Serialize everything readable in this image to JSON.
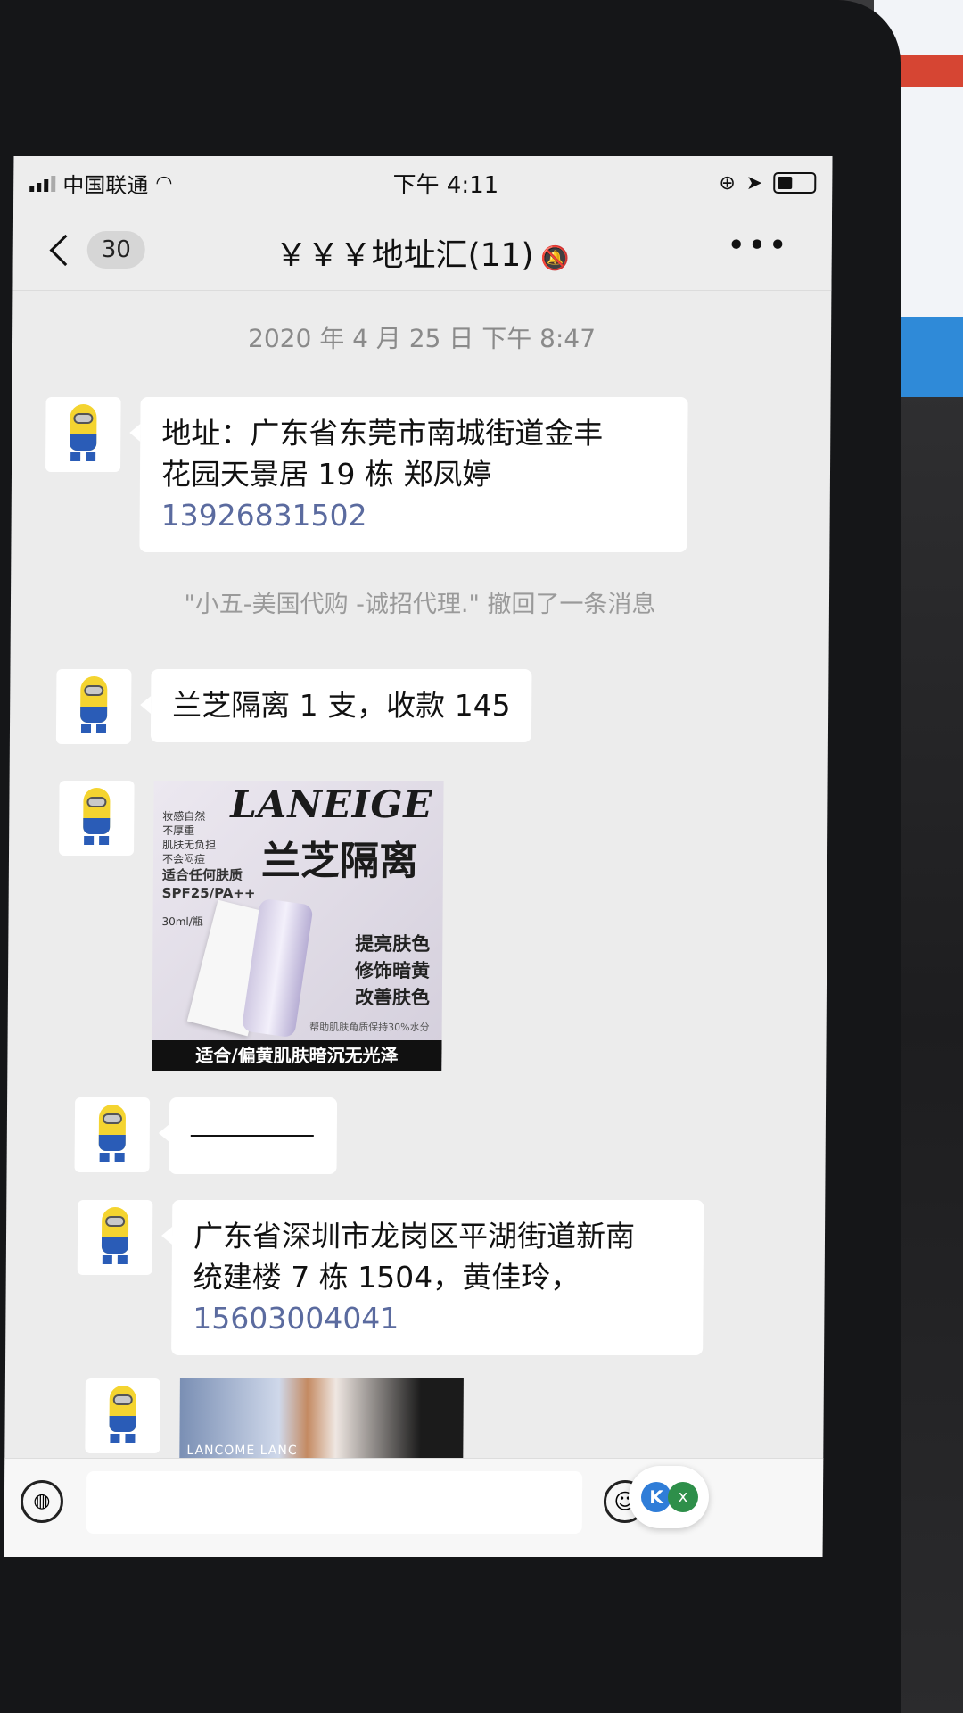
{
  "status_bar": {
    "carrier": "中国联通",
    "time": "下午 4:11"
  },
  "nav": {
    "unread_count": "30",
    "title": "￥￥￥地址汇(11)"
  },
  "chat": {
    "timestamp": "2020 年 4 月 25 日 下午 8:47",
    "messages": [
      {
        "lines": [
          "地址：广东省东莞市南城街道金丰",
          "花园天景居 19 栋 郑凤婷"
        ],
        "phone": "13926831502"
      },
      {
        "text": "兰芝隔离 1 支，收款 145"
      },
      {
        "lines": [
          "广东省深圳市龙岗区平湖街道新南",
          "统建楼 7 栋 1504，黄佳玲，"
        ],
        "phone": "15603004041"
      }
    ],
    "recall_notice": "\"小五-美国代购 -诚招代理.\" 撤回了一条消息"
  },
  "product_image": {
    "brand": "LANEIGE",
    "cn_name": "兰芝隔离",
    "left_lines": [
      "妆感自然",
      "不厚重",
      "肌肤无负担",
      "不会闷痘"
    ],
    "left_big": [
      "适合任何肤质",
      "SPF25/PA++"
    ],
    "volume": "30ml/瓶",
    "features": [
      "提亮肤色",
      "修饰暗黄",
      "改善肤色"
    ],
    "note": "帮助肌肤角质保持30%水分",
    "band": "适合/偏黄肌肤暗沉无光泽"
  },
  "photo_preview": {
    "caption": "LANCOME LANC"
  },
  "input_bar": {
    "voice_icon": "voice-icon",
    "emoji_icon": "emoji-icon",
    "float_k": "K",
    "float_x": "x"
  },
  "colors": {
    "phone_link": "#5b6b9f",
    "chat_bg": "#ececec"
  }
}
